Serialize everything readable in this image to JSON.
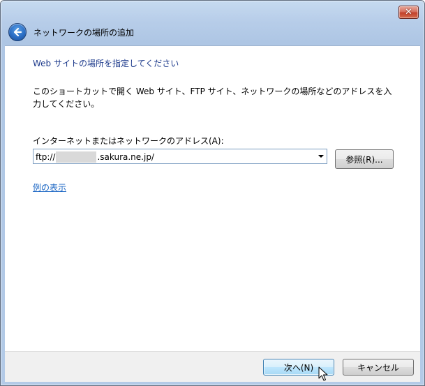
{
  "window": {
    "close_label": "✕"
  },
  "header": {
    "title": "ネットワークの場所の追加"
  },
  "main": {
    "title": "Web サイトの場所を指定してください",
    "description": "このショートカットで開く Web サイト、FTP サイト、ネットワークの場所などのアドレスを入力してください。",
    "address_label": "インターネットまたはネットワークのアドレス(A):",
    "address_prefix": "ftp://",
    "address_suffix": ".sakura.ne.jp/",
    "browse_label": "参照(R)...",
    "example_link": "例の表示"
  },
  "footer": {
    "next_label": "次へ(N)",
    "cancel_label": "キャンセル"
  },
  "icons": {
    "back": "back-arrow-icon",
    "close": "close-icon",
    "dropdown": "chevron-down-icon",
    "cursor": "mouse-pointer-icon"
  },
  "colors": {
    "title_text": "#1e3b8c",
    "link": "#1b66c4",
    "close_button": "#c2412b",
    "default_button_border": "#3c7fb1"
  }
}
